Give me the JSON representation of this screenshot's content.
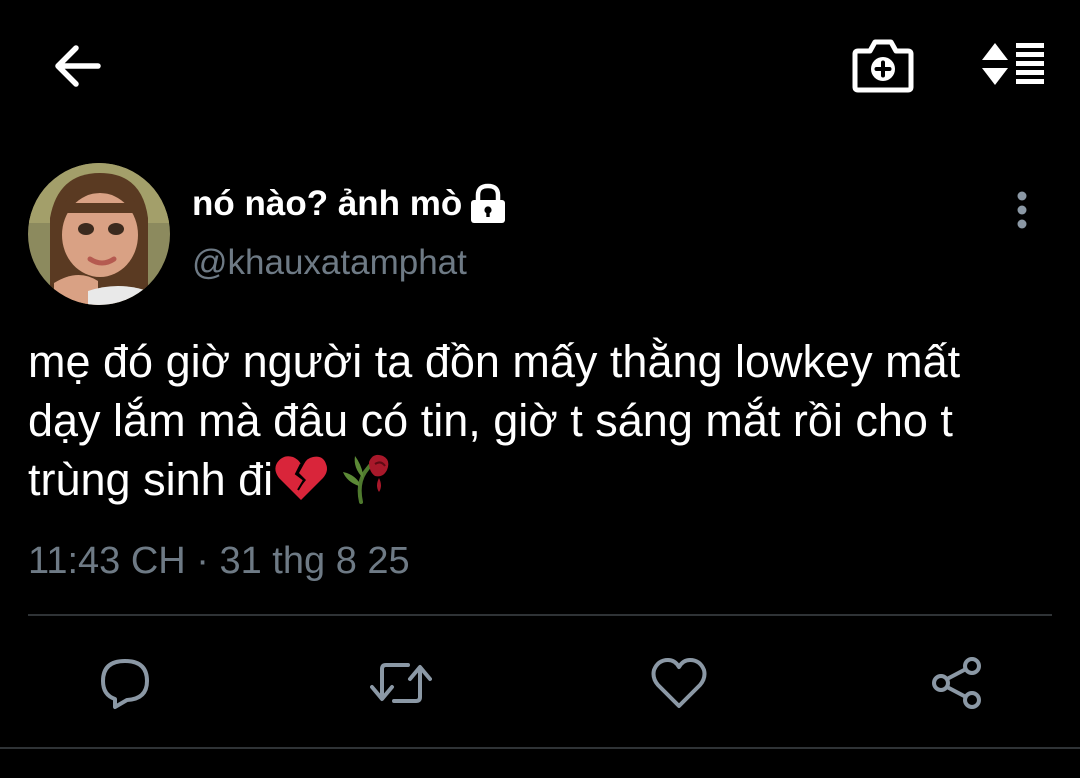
{
  "topbar": {
    "back_icon": "arrow-left-icon",
    "camera_icon": "camera-plus-icon",
    "sort_icon": "sort-list-icon"
  },
  "tweet": {
    "display_name": "nó nào? ảnh mò",
    "protected_icon": "lock-icon",
    "handle": "@khauxatamphat",
    "text_lines": [
      "mẹ đó giờ người ta đồn mấy thằng lowkey mất",
      "dạy lắm mà đâu có tin, giờ t sáng mắt rồi cho t",
      "trùng sinh đi"
    ],
    "emojis": [
      "💔",
      "🥀"
    ],
    "timestamp": "11:43 CH · 31 thg 8 25"
  },
  "actions": {
    "reply_icon": "reply-icon",
    "retweet_icon": "retweet-icon",
    "like_icon": "heart-icon",
    "share_icon": "share-icon"
  },
  "colors": {
    "background": "#000000",
    "text": "#ffffff",
    "secondary_text": "#6e7a85",
    "divider": "#2f3336",
    "icon": "#8b98a5"
  }
}
